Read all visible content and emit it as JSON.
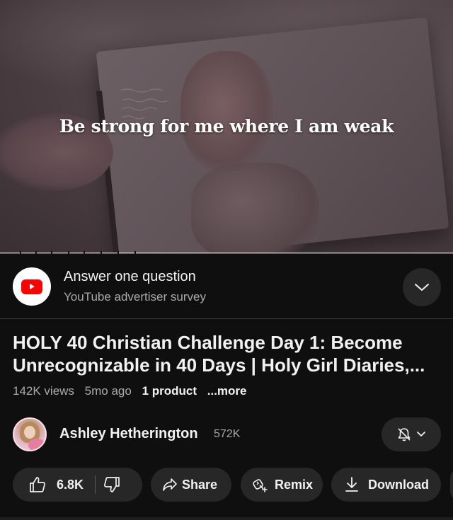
{
  "video": {
    "caption": "Be strong for me where I am weak",
    "progress": 0.0
  },
  "ad": {
    "title": "Answer one question",
    "subtitle": "YouTube advertiser survey",
    "logo_icon": "youtube-logo-icon",
    "chevron_icon": "chevron-down-icon"
  },
  "video_info": {
    "title": "HOLY 40 Christian Challenge Day 1: Become Unrecognizable in 40 Days | Holy Girl Diaries,...",
    "views": "142K views",
    "age": "5mo ago",
    "products": "1 product",
    "more": "...more"
  },
  "channel": {
    "name": "Ashley Hetherington",
    "subscribers": "572K",
    "bell_icon": "bell-off-icon"
  },
  "actions": {
    "likes": "6.8K",
    "share": "Share",
    "remix": "Remix",
    "download": "Download"
  },
  "colors": {
    "background": "#0f0f0f",
    "pill": "#272727",
    "accent": "#ff0000",
    "secondary_text": "#aaaaaa"
  }
}
